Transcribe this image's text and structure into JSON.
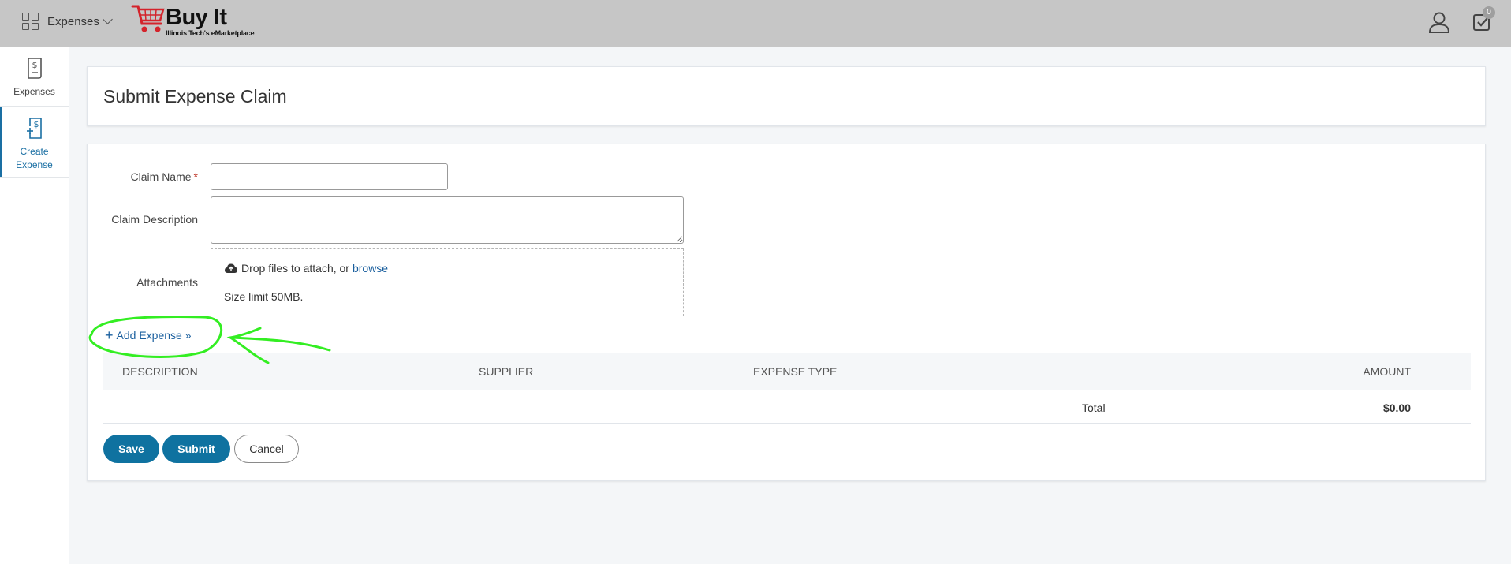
{
  "header": {
    "app_switcher_label": "Expenses",
    "logo_title": "Buy It",
    "logo_subtitle": "Illinois Tech's eMarketplace",
    "tasks_count": "0"
  },
  "sidebar": {
    "items": [
      {
        "label": "Expenses",
        "icon": "receipt-icon"
      },
      {
        "label": "Create Expense",
        "icon": "create-expense-icon"
      }
    ]
  },
  "page": {
    "title": "Submit Expense Claim"
  },
  "form": {
    "claim_name_label": "Claim Name",
    "required_mark": "*",
    "claim_name_value": "",
    "claim_description_label": "Claim Description",
    "claim_description_value": "",
    "attachments_label": "Attachments",
    "drop_text": "Drop files to attach, or",
    "browse_link": "browse",
    "size_limit": "Size limit 50MB.",
    "add_expense_label": "Add Expense »"
  },
  "table": {
    "columns": [
      "DESCRIPTION",
      "SUPPLIER",
      "EXPENSE TYPE",
      "AMOUNT"
    ],
    "total_label": "Total",
    "total_value": "$0.00"
  },
  "actions": {
    "save_label": "Save",
    "submit_label": "Submit",
    "cancel_label": "Cancel"
  },
  "colors": {
    "accent": "#0f72a0",
    "link": "#1a5f9e",
    "topbar": "#c6c6c6",
    "annotation": "#33ee22"
  }
}
